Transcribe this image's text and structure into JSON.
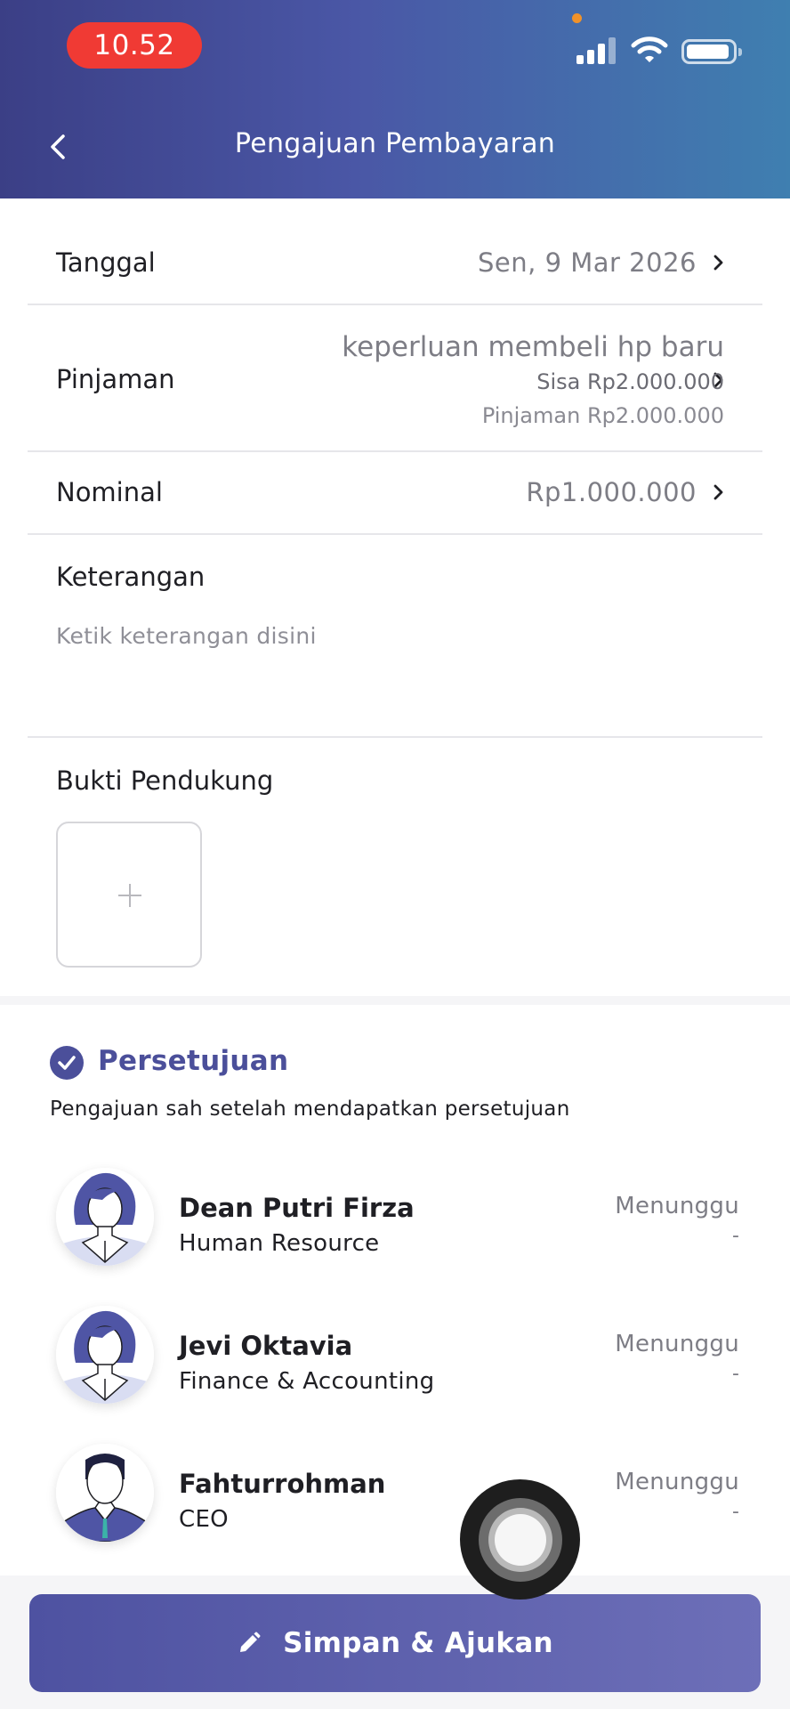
{
  "status_bar": {
    "time": "10.52"
  },
  "header": {
    "title": "Pengajuan Pembayaran"
  },
  "form": {
    "tanggal": {
      "label": "Tanggal",
      "value": "Sen, 9 Mar 2026"
    },
    "pinjaman": {
      "label": "Pinjaman",
      "loan_name": "keperluan membeli hp baru",
      "remaining": "Sisa Rp2.000.000",
      "total": "Pinjaman Rp2.000.000"
    },
    "nominal": {
      "label": "Nominal",
      "value": "Rp1.000.000"
    },
    "keterangan": {
      "label": "Keterangan",
      "placeholder": "Ketik keterangan disini"
    },
    "bukti": {
      "label": "Bukti Pendukung"
    }
  },
  "approval": {
    "title": "Persetujuan",
    "description": "Pengajuan sah setelah mendapatkan persetujuan",
    "approvers": [
      {
        "name": "Dean Putri Firza",
        "role": "Human Resource",
        "status": "Menunggu",
        "date": "-",
        "avatar": "female-avatar"
      },
      {
        "name": "Jevi Oktavia",
        "role": "Finance & Accounting",
        "status": "Menunggu",
        "date": "-",
        "avatar": "female-avatar"
      },
      {
        "name": "Fahturrohman",
        "role": "CEO",
        "status": "Menunggu",
        "date": "-",
        "avatar": "male-avatar"
      }
    ]
  },
  "actions": {
    "submit_label": "Simpan & Ajukan",
    "submit_icon": "pencil-icon"
  },
  "colors": {
    "accent": "#4b4f9a",
    "time_pill": "#f03a34"
  }
}
